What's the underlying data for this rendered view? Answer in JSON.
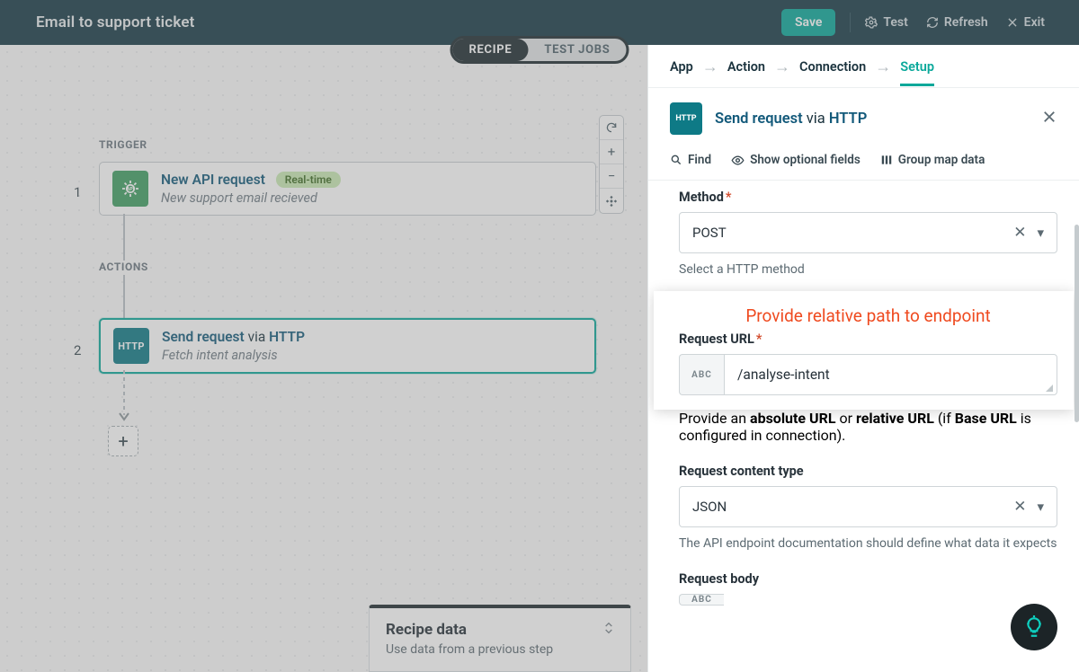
{
  "header": {
    "title": "Email to support ticket",
    "save": "Save",
    "test": "Test",
    "refresh": "Refresh",
    "exit": "Exit"
  },
  "mode": {
    "recipe": "RECIPE",
    "test_jobs": "TEST JOBS"
  },
  "canvas": {
    "trigger_label": "TRIGGER",
    "actions_label": "ACTIONS",
    "step1_num": "1",
    "step2_num": "2",
    "step1": {
      "title_strong": "New API request",
      "badge": "Real-time",
      "subtitle": "New support email recieved"
    },
    "step2": {
      "title_strong": "Send request",
      "title_rest": " via ",
      "title_http": "HTTP",
      "subtitle": "Fetch intent analysis"
    },
    "add": "+"
  },
  "panel": {
    "crumbs": {
      "app": "App",
      "action": "Action",
      "connection": "Connection",
      "setup": "Setup"
    },
    "head": {
      "strong": "Send request",
      "rest": " via ",
      "http": "HTTP"
    },
    "toolbar": {
      "find": "Find",
      "optional": "Show optional fields",
      "group": "Group map data"
    },
    "method": {
      "label": "Method",
      "value": "POST",
      "help": "Select a HTTP method"
    },
    "callout": "Provide relative path to endpoint",
    "url": {
      "label": "Request URL",
      "prefix": "ABC",
      "value": "/analyse-intent",
      "help_1": "Provide an ",
      "help_b1": "absolute URL",
      "help_2": " or ",
      "help_b2": "relative URL",
      "help_3": " (if ",
      "help_b3": "Base URL",
      "help_4": " is configured in connection)."
    },
    "content_type": {
      "label": "Request content type",
      "value": "JSON",
      "help": "The API endpoint documentation should define what data it expects"
    },
    "body": {
      "label": "Request body",
      "prefix": "ABC"
    }
  },
  "tray": {
    "title": "Recipe data",
    "subtitle": "Use data from a previous step"
  }
}
